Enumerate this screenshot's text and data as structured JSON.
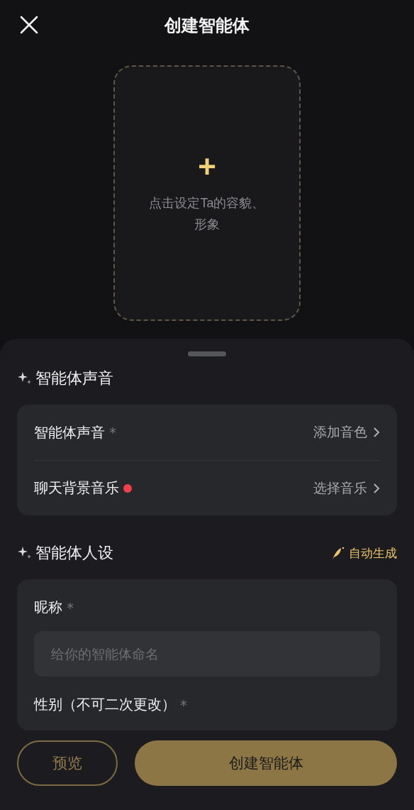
{
  "header": {
    "title": "创建智能体"
  },
  "avatar_upload": {
    "plus": "+",
    "hint": "点击设定Ta的容貌、形象"
  },
  "sections": [
    {
      "title": "智能体声音",
      "rows": [
        {
          "label": "智能体声音",
          "required_mark": "*",
          "badge": false,
          "value": "添加音色"
        },
        {
          "label": "聊天背景音乐",
          "badge": true,
          "value": "选择音乐"
        }
      ]
    },
    {
      "title": "智能体人设",
      "action": "自动生成",
      "fields": [
        {
          "label": "昵称",
          "required_mark": "*",
          "placeholder": "给你的智能体命名"
        },
        {
          "label": "性别（不可二次更改）",
          "required_mark": "*"
        }
      ]
    }
  ],
  "footer": {
    "buttons": [
      {
        "label": "预览",
        "kind": "outline"
      },
      {
        "label": "创建智能体",
        "kind": "primary"
      }
    ]
  }
}
